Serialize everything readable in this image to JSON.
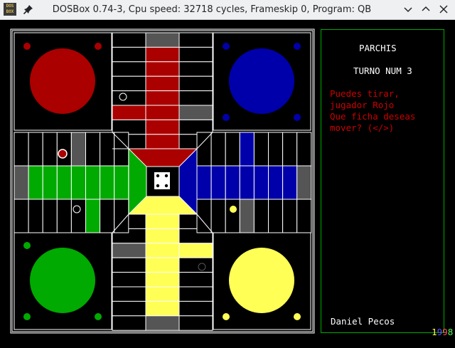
{
  "window": {
    "app_icon_text": "DOS\nBOX",
    "title": "DOSBox 0.74-3, Cpu speed: 32718 cycles, Frameskip 0, Program: QB",
    "icons": [
      "pin-icon",
      "minimize-icon",
      "maximize-icon",
      "close-icon"
    ]
  },
  "game": {
    "title": "PARCHIS",
    "turn": "TURNO NUM 3",
    "message_lines": [
      "Puedes tirar,",
      "jugador Rojo",
      "Que ficha deseas",
      "mover? (</>)"
    ],
    "author": "Daniel Pecos",
    "year_digits": [
      "1",
      "9",
      "9",
      "8"
    ],
    "colors": {
      "red": "#aa0000",
      "blue": "#0000aa",
      "green": "#00aa00",
      "yellow": "#ffff55",
      "gray": "#555555",
      "panel_border": "#00aa00",
      "year": [
        "#ffff55",
        "#5555ff",
        "#ff5555",
        "#55ff55"
      ]
    },
    "dice_value": 4
  }
}
